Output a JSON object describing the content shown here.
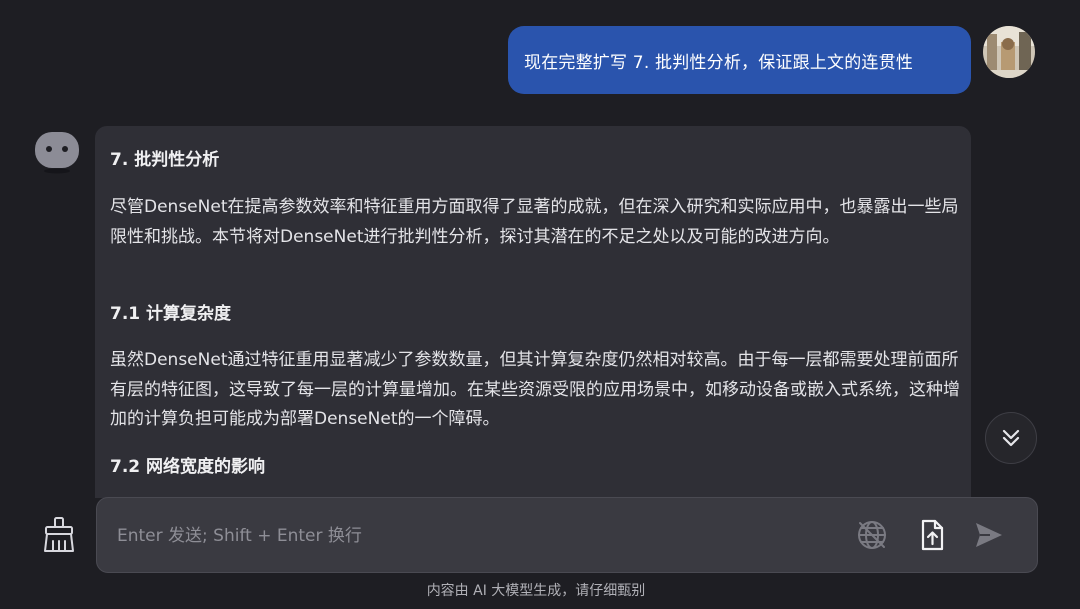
{
  "user_message": {
    "text": "现在完整扩写 7. 批判性分析，保证跟上文的连贯性"
  },
  "assistant_message": {
    "heading": "7. 批判性分析",
    "intro": "尽管DenseNet在提高参数效率和特征重用方面取得了显著的成就，但在深入研究和实际应用中，也暴露出一些局限性和挑战。本节将对DenseNet进行批判性分析，探讨其潜在的不足之处以及可能的改进方向。",
    "section_1_title": "7.1 计算复杂度",
    "section_1_body": "虽然DenseNet通过特征重用显著减少了参数数量，但其计算复杂度仍然相对较高。由于每一层都需要处理前面所有层的特征图，这导致了每一层的计算量增加。在某些资源受限的应用场景中，如移动设备或嵌入式系统，这种增加的计算负担可能成为部署DenseNet的一个障碍。",
    "section_2_title": "7.2 网络宽度的影响"
  },
  "composer": {
    "placeholder": "Enter 发送; Shift + Enter 换行",
    "value": ""
  },
  "icons": {
    "clear": "broom-icon",
    "web_search": "globe-off-icon",
    "upload": "file-upload-icon",
    "send": "send-icon",
    "scroll": "double-chevron-down-icon"
  },
  "colors": {
    "background": "#1e1e23",
    "user_bubble": "#2a54ad",
    "assistant_card": "#2f2f36",
    "input": "#3a3a41"
  },
  "footer": {
    "disclaimer": "内容由 AI 大模型生成，请仔细甄别"
  }
}
